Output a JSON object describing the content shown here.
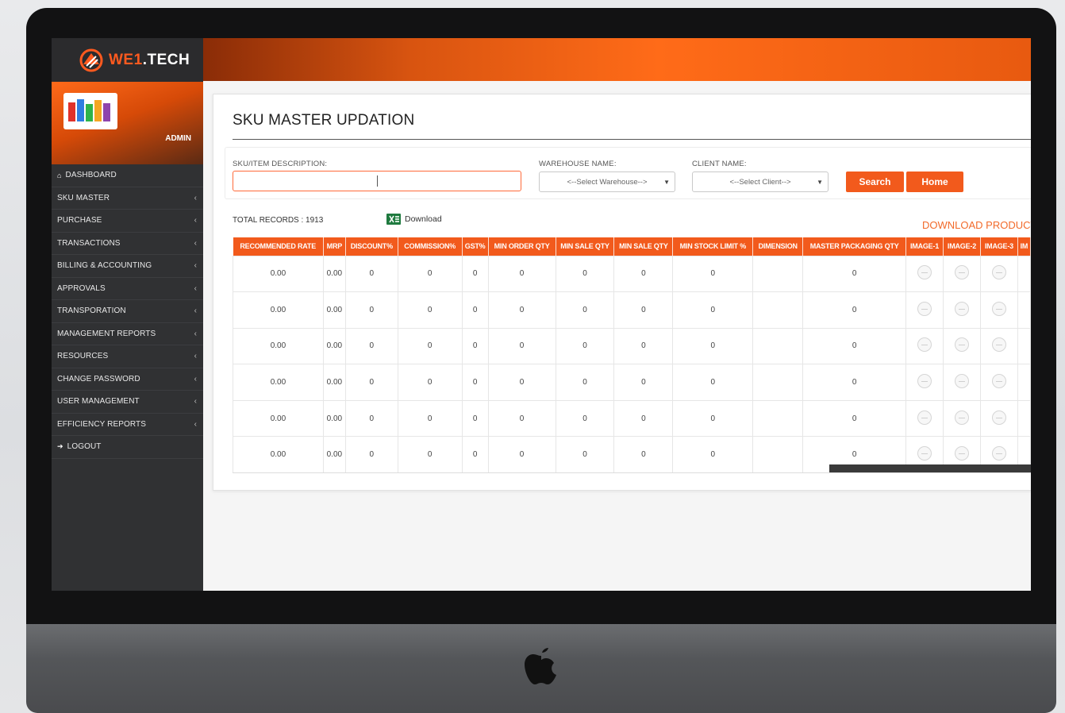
{
  "brand": {
    "name_part1": "WE1",
    "name_part2": ".TECH",
    "user_role": "ADMIN"
  },
  "sidebar": {
    "items": [
      {
        "label": "DASHBOARD",
        "icon": "home-icon",
        "has_chevron": false
      },
      {
        "label": "SKU MASTER",
        "has_chevron": true
      },
      {
        "label": "PURCHASE",
        "has_chevron": true
      },
      {
        "label": "TRANSACTIONS",
        "has_chevron": true
      },
      {
        "label": "BILLING & ACCOUNTING",
        "has_chevron": true
      },
      {
        "label": "APPROVALS",
        "has_chevron": true
      },
      {
        "label": "TRANSPORATION",
        "has_chevron": true
      },
      {
        "label": "MANAGEMENT REPORTS",
        "has_chevron": true
      },
      {
        "label": "RESOURCES",
        "has_chevron": true
      },
      {
        "label": "CHANGE PASSWORD",
        "has_chevron": true
      },
      {
        "label": "USER MANAGEMENT",
        "has_chevron": true
      },
      {
        "label": "EFFICIENCY REPORTS",
        "has_chevron": true
      },
      {
        "label": "LOGOUT",
        "icon": "logout-icon",
        "has_chevron": false
      }
    ]
  },
  "page": {
    "title": "SKU MASTER UPDATION"
  },
  "filters": {
    "sku_label": "SKU/ITEM DESCRIPTION:",
    "sku_value": "",
    "warehouse_label": "WAREHOUSE NAME:",
    "warehouse_selected": "<--Select Warehouse-->",
    "client_label": "CLIENT NAME:",
    "client_selected": "<--Select Client-->",
    "search_button": "Search",
    "home_button": "Home"
  },
  "summary": {
    "total_records": "TOTAL RECORDS : 1913",
    "download_label": "Download",
    "download_products": "DOWNLOAD PRODUCT"
  },
  "table": {
    "columns": [
      "RECOMMENDED RATE",
      "MRP",
      "DISCOUNT%",
      "COMMISSION%",
      "GST%",
      "MIN ORDER QTY",
      "MIN SALE QTY",
      "MIN SALE QTY",
      "MIN STOCK LIMIT %",
      "DIMENSION",
      "MASTER PACKAGING QTY",
      "IMAGE-1",
      "IMAGE-2",
      "IMAGE-3",
      "IM"
    ],
    "rows": [
      [
        "0.00",
        "0.00",
        "0",
        "0",
        "0",
        "0",
        "0",
        "0",
        "0",
        "",
        "0"
      ],
      [
        "0.00",
        "0.00",
        "0",
        "0",
        "0",
        "0",
        "0",
        "0",
        "0",
        "",
        "0"
      ],
      [
        "0.00",
        "0.00",
        "0",
        "0",
        "0",
        "0",
        "0",
        "0",
        "0",
        "",
        "0"
      ],
      [
        "0.00",
        "0.00",
        "0",
        "0",
        "0",
        "0",
        "0",
        "0",
        "0",
        "",
        "0"
      ],
      [
        "0.00",
        "0.00",
        "0",
        "0",
        "0",
        "0",
        "0",
        "0",
        "0",
        "",
        "0"
      ],
      [
        "0.00",
        "0.00",
        "0",
        "0",
        "0",
        "0",
        "0",
        "0",
        "0",
        "",
        "0"
      ]
    ]
  },
  "colors": {
    "accent": "#f25a1c",
    "sidebar_bg": "#303133"
  }
}
